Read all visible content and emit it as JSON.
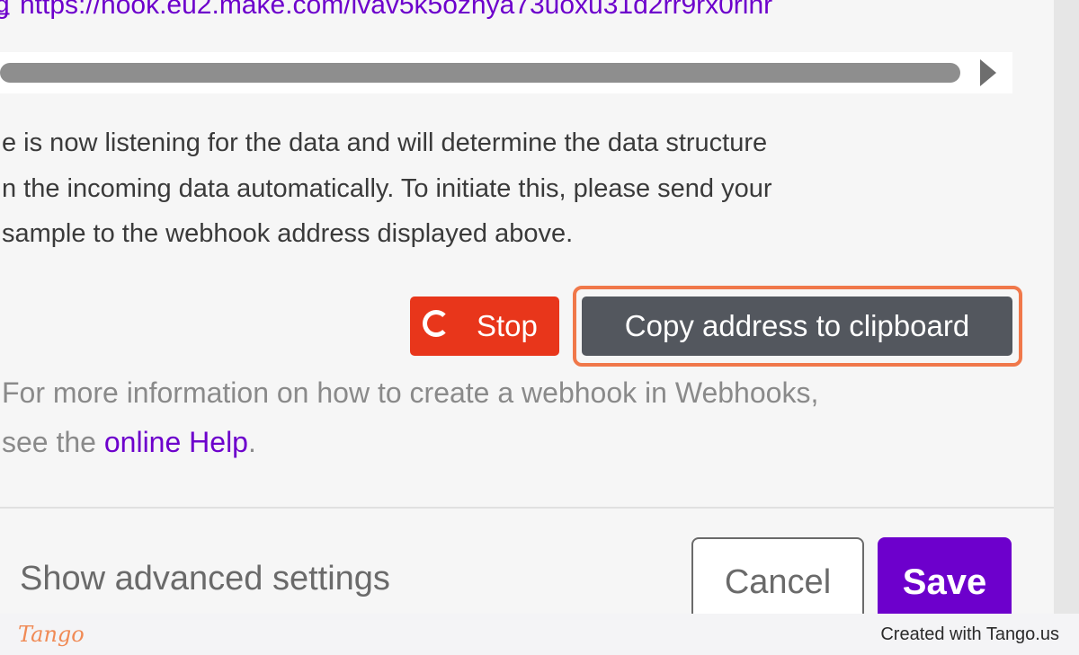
{
  "webhook": {
    "url": "https://hook.eu2.make.com/ivav5k5ozhya73uoxu31d2rr9rx0rinr"
  },
  "info": {
    "line1": "e is now listening for the data and will determine the data structure",
    "line2": "n the incoming data automatically. To initiate this, please send your",
    "line3": "sample to the webhook address displayed above."
  },
  "actions": {
    "stop_label": "Stop",
    "copy_label": "Copy address to clipboard"
  },
  "help": {
    "line1": "For more information on how to create a webhook in Webhooks,",
    "line2_prefix": "see the ",
    "link_text": "online Help",
    "line2_suffix": "."
  },
  "footer_bar": {
    "advanced_label": "Show advanced settings",
    "cancel_label": "Cancel",
    "save_label": "Save"
  },
  "branding": {
    "logo_text": "Tango",
    "credit_text": "Created with Tango.us"
  },
  "colors": {
    "accent": "#6d00cc",
    "stop": "#e8361b",
    "copy_button": "#53575e",
    "highlight": "#f0784a"
  },
  "icons": {
    "stop": "spinner-icon",
    "scroll": "arrow-right-icon"
  }
}
